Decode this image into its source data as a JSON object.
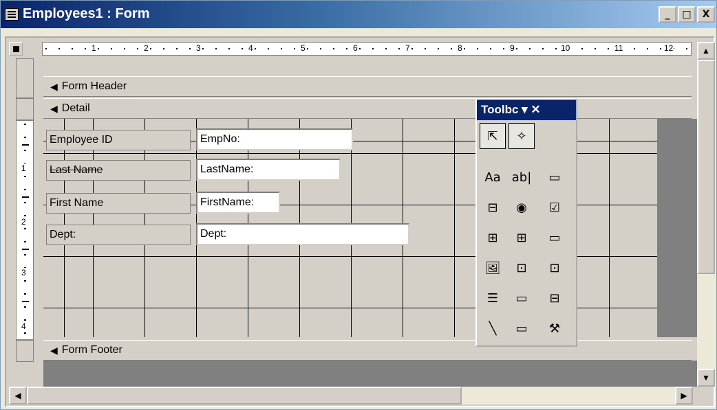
{
  "window": {
    "title": "Employees1 : Form",
    "minimize": "_",
    "maximize": "□",
    "close": "X"
  },
  "ruler": {
    "h_numbers": [
      "1",
      "2",
      "3",
      "4",
      "5",
      "6",
      "7",
      "8",
      "9",
      "10",
      "11",
      "12"
    ],
    "v_numbers": [
      "1",
      "2",
      "3",
      "4"
    ]
  },
  "sections": {
    "header": "Form Header",
    "detail": "Detail",
    "footer": "Form Footer"
  },
  "fields": [
    {
      "label": "Employee ID",
      "textbox": "EmpNo:"
    },
    {
      "label": "Last Name",
      "textbox": "LastName:"
    },
    {
      "label": "First Name",
      "textbox": "FirstName:"
    },
    {
      "label": "Dept:",
      "textbox": "Dept:"
    }
  ],
  "toolbox": {
    "title": "Toolbc ▾ ✕",
    "tools": [
      "select-objects",
      "control-wizards",
      "label",
      "text-box",
      "option-group",
      "toggle-button",
      "option-button",
      "check-box",
      "combo-box",
      "list-box",
      "command-button",
      "image",
      "unbound-object-frame",
      "bound-object-frame",
      "page-break",
      "tab-control",
      "subform",
      "line",
      "rectangle",
      "more-controls"
    ],
    "glyphs": [
      "⇱",
      "✧",
      "Aa",
      "ab|",
      "▭",
      "⊟",
      "◉",
      "☑",
      "⊞",
      "⊞",
      "▭",
      "🖼",
      "⊡",
      "⊡",
      "☰",
      "▭",
      "⊟",
      "╲",
      "▭",
      "⚒"
    ]
  },
  "scroll": {
    "up": "▲",
    "down": "▼",
    "left": "◀",
    "right": "▶"
  },
  "colors": {
    "titlebar_start": "#0a246a",
    "titlebar_end": "#a6caf0",
    "face": "#d4d0c8"
  }
}
